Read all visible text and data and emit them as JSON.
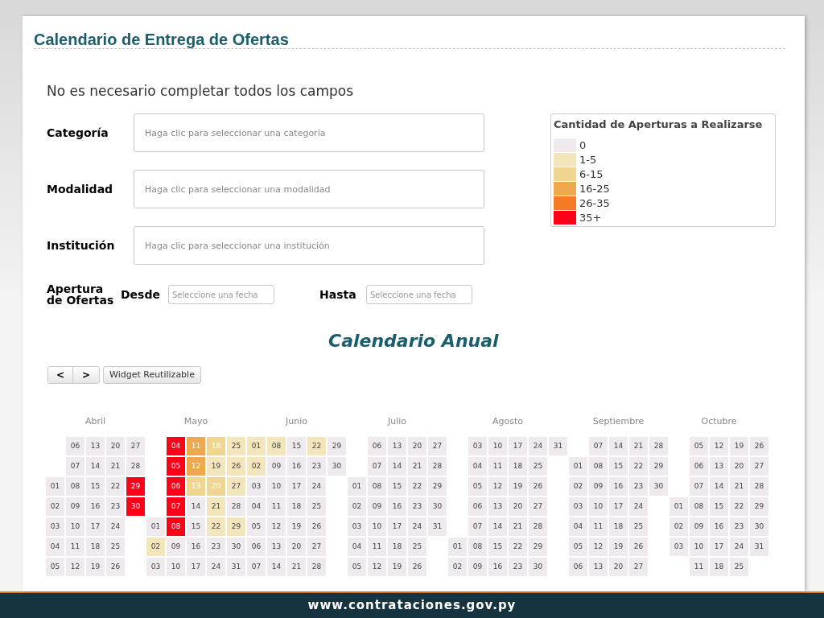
{
  "title": "Calendario de Entrega de Ofertas",
  "intro": "No es necesario completar todos los campos",
  "fields": [
    {
      "label": "Categoría",
      "placeholder": "Haga clic para seleccionar una categoría"
    },
    {
      "label": "Modalidad",
      "placeholder": "Haga clic para seleccionar una modalidad"
    },
    {
      "label": "Institución",
      "placeholder": "Haga clic para seleccionar una institución"
    }
  ],
  "date_range": {
    "label": "Apertura de Ofertas",
    "from_label": "Desde",
    "from_placeholder": "Seleccione una fecha",
    "to_label": "Hasta",
    "to_placeholder": "Seleccione una fecha"
  },
  "legend": {
    "title": "Cantidad de Aperturas a Realizarse",
    "items": [
      {
        "label": "0",
        "color": "#eeeaee"
      },
      {
        "label": "1-5",
        "color": "#f3e6bd"
      },
      {
        "label": "6-15",
        "color": "#f0d690"
      },
      {
        "label": "16-25",
        "color": "#f0a84e"
      },
      {
        "label": "26-35",
        "color": "#f57b26"
      },
      {
        "label": "35+",
        "color": "#ff0018"
      }
    ]
  },
  "calendar_title": "Calendario Anual",
  "nav": {
    "prev": "<",
    "next": ">",
    "widget": "Widget Reutilizable"
  },
  "months": [
    {
      "name": "Abril",
      "weeks": [
        [
          {
            "kind": "blank"
          },
          {
            "kind": "blank"
          },
          {
            "kind": "day",
            "day": "01"
          },
          {
            "kind": "day",
            "day": "02"
          },
          {
            "kind": "day",
            "day": "03"
          },
          {
            "kind": "day",
            "day": "04"
          },
          {
            "kind": "day",
            "day": "05"
          }
        ],
        [
          {
            "kind": "day",
            "day": "06"
          },
          {
            "kind": "day",
            "day": "07"
          },
          {
            "kind": "day",
            "day": "08"
          },
          {
            "kind": "day",
            "day": "09"
          },
          {
            "kind": "day",
            "day": "10"
          },
          {
            "kind": "day",
            "day": "11"
          },
          {
            "kind": "day",
            "day": "12"
          }
        ],
        [
          {
            "kind": "day",
            "day": "13"
          },
          {
            "kind": "day",
            "day": "14"
          },
          {
            "kind": "day",
            "day": "15"
          },
          {
            "kind": "day",
            "day": "16"
          },
          {
            "kind": "day",
            "day": "17"
          },
          {
            "kind": "day",
            "day": "18"
          },
          {
            "kind": "day",
            "day": "19"
          }
        ],
        [
          {
            "kind": "day",
            "day": "20"
          },
          {
            "kind": "day",
            "day": "21"
          },
          {
            "kind": "day",
            "day": "22"
          },
          {
            "kind": "day",
            "day": "23"
          },
          {
            "kind": "day",
            "day": "24"
          },
          {
            "kind": "day",
            "day": "25"
          },
          {
            "kind": "day",
            "day": "26"
          }
        ],
        [
          {
            "kind": "day",
            "day": "27"
          },
          {
            "kind": "day",
            "day": "28"
          },
          {
            "kind": "day",
            "day": "29",
            "color": "#ff0018"
          },
          {
            "kind": "day",
            "day": "30",
            "color": "#ff0018"
          }
        ]
      ]
    },
    {
      "name": "Mayo",
      "weeks": [
        [
          {
            "kind": "blank"
          },
          {
            "kind": "blank"
          },
          {
            "kind": "blank"
          },
          {
            "kind": "blank"
          },
          {
            "kind": "day",
            "day": "01"
          },
          {
            "kind": "day",
            "day": "02",
            "color": "#f3e6bd"
          },
          {
            "kind": "day",
            "day": "03"
          }
        ],
        [
          {
            "kind": "day",
            "day": "04",
            "color": "#ff0018"
          },
          {
            "kind": "day",
            "day": "05",
            "color": "#ff0018"
          },
          {
            "kind": "day",
            "day": "06",
            "color": "#ff0018"
          },
          {
            "kind": "day",
            "day": "07",
            "color": "#ff0018"
          },
          {
            "kind": "day",
            "day": "08",
            "color": "#ff0018"
          },
          {
            "kind": "day",
            "day": "09"
          },
          {
            "kind": "day",
            "day": "10"
          }
        ],
        [
          {
            "kind": "day",
            "day": "11",
            "color": "#f0a84e"
          },
          {
            "kind": "day",
            "day": "12",
            "color": "#f0a84e"
          },
          {
            "kind": "day",
            "day": "13",
            "color": "#f0d690"
          },
          {
            "kind": "day",
            "day": "14"
          },
          {
            "kind": "day",
            "day": "15"
          },
          {
            "kind": "day",
            "day": "16"
          },
          {
            "kind": "day",
            "day": "17"
          }
        ],
        [
          {
            "kind": "day",
            "day": "18",
            "color": "#f0d690"
          },
          {
            "kind": "day",
            "day": "19",
            "color": "#f3e6bd"
          },
          {
            "kind": "day",
            "day": "20",
            "color": "#f0d690"
          },
          {
            "kind": "day",
            "day": "21",
            "color": "#f3e6bd"
          },
          {
            "kind": "day",
            "day": "22",
            "color": "#f3e6bd"
          },
          {
            "kind": "day",
            "day": "23"
          },
          {
            "kind": "day",
            "day": "24"
          }
        ],
        [
          {
            "kind": "day",
            "day": "25",
            "color": "#f3e6bd"
          },
          {
            "kind": "day",
            "day": "26",
            "color": "#f3e6bd"
          },
          {
            "kind": "day",
            "day": "27",
            "color": "#f3e6bd"
          },
          {
            "kind": "day",
            "day": "28"
          },
          {
            "kind": "day",
            "day": "29",
            "color": "#f3e6bd"
          },
          {
            "kind": "day",
            "day": "30"
          },
          {
            "kind": "day",
            "day": "31"
          }
        ]
      ]
    },
    {
      "name": "Junio",
      "weeks": [
        [
          {
            "kind": "day",
            "day": "01",
            "color": "#f3e6bd"
          },
          {
            "kind": "day",
            "day": "02",
            "color": "#f3e6bd"
          },
          {
            "kind": "day",
            "day": "03"
          },
          {
            "kind": "day",
            "day": "04"
          },
          {
            "kind": "day",
            "day": "05"
          },
          {
            "kind": "day",
            "day": "06"
          },
          {
            "kind": "day",
            "day": "07"
          }
        ],
        [
          {
            "kind": "day",
            "day": "08",
            "color": "#f3e6bd"
          },
          {
            "kind": "day",
            "day": "09"
          },
          {
            "kind": "day",
            "day": "10"
          },
          {
            "kind": "day",
            "day": "11"
          },
          {
            "kind": "day",
            "day": "12"
          },
          {
            "kind": "day",
            "day": "13"
          },
          {
            "kind": "day",
            "day": "14"
          }
        ],
        [
          {
            "kind": "day",
            "day": "15"
          },
          {
            "kind": "day",
            "day": "16"
          },
          {
            "kind": "day",
            "day": "17"
          },
          {
            "kind": "day",
            "day": "18"
          },
          {
            "kind": "day",
            "day": "19"
          },
          {
            "kind": "day",
            "day": "20"
          },
          {
            "kind": "day",
            "day": "21"
          }
        ],
        [
          {
            "kind": "day",
            "day": "22",
            "color": "#f3e6bd"
          },
          {
            "kind": "day",
            "day": "23"
          },
          {
            "kind": "day",
            "day": "24"
          },
          {
            "kind": "day",
            "day": "25"
          },
          {
            "kind": "day",
            "day": "26"
          },
          {
            "kind": "day",
            "day": "27"
          },
          {
            "kind": "day",
            "day": "28"
          }
        ],
        [
          {
            "kind": "day",
            "day": "29"
          },
          {
            "kind": "day",
            "day": "30"
          }
        ]
      ]
    },
    {
      "name": "Julio",
      "weeks": [
        [
          {
            "kind": "blank"
          },
          {
            "kind": "blank"
          },
          {
            "kind": "day",
            "day": "01"
          },
          {
            "kind": "day",
            "day": "02"
          },
          {
            "kind": "day",
            "day": "03"
          },
          {
            "kind": "day",
            "day": "04"
          },
          {
            "kind": "day",
            "day": "05"
          }
        ],
        [
          {
            "kind": "day",
            "day": "06"
          },
          {
            "kind": "day",
            "day": "07"
          },
          {
            "kind": "day",
            "day": "08"
          },
          {
            "kind": "day",
            "day": "09"
          },
          {
            "kind": "day",
            "day": "10"
          },
          {
            "kind": "day",
            "day": "11"
          },
          {
            "kind": "day",
            "day": "12"
          }
        ],
        [
          {
            "kind": "day",
            "day": "13"
          },
          {
            "kind": "day",
            "day": "14"
          },
          {
            "kind": "day",
            "day": "15"
          },
          {
            "kind": "day",
            "day": "16"
          },
          {
            "kind": "day",
            "day": "17"
          },
          {
            "kind": "day",
            "day": "18"
          },
          {
            "kind": "day",
            "day": "19"
          }
        ],
        [
          {
            "kind": "day",
            "day": "20"
          },
          {
            "kind": "day",
            "day": "21"
          },
          {
            "kind": "day",
            "day": "22"
          },
          {
            "kind": "day",
            "day": "23"
          },
          {
            "kind": "day",
            "day": "24"
          },
          {
            "kind": "day",
            "day": "25"
          },
          {
            "kind": "day",
            "day": "26"
          }
        ],
        [
          {
            "kind": "day",
            "day": "27"
          },
          {
            "kind": "day",
            "day": "28"
          },
          {
            "kind": "day",
            "day": "29"
          },
          {
            "kind": "day",
            "day": "30"
          },
          {
            "kind": "day",
            "day": "31"
          }
        ]
      ]
    },
    {
      "name": "Agosto",
      "weeks": [
        [
          {
            "kind": "blank"
          },
          {
            "kind": "blank"
          },
          {
            "kind": "blank"
          },
          {
            "kind": "blank"
          },
          {
            "kind": "blank"
          },
          {
            "kind": "day",
            "day": "01"
          },
          {
            "kind": "day",
            "day": "02"
          }
        ],
        [
          {
            "kind": "day",
            "day": "03"
          },
          {
            "kind": "day",
            "day": "04"
          },
          {
            "kind": "day",
            "day": "05"
          },
          {
            "kind": "day",
            "day": "06"
          },
          {
            "kind": "day",
            "day": "07"
          },
          {
            "kind": "day",
            "day": "08"
          },
          {
            "kind": "day",
            "day": "09"
          }
        ],
        [
          {
            "kind": "day",
            "day": "10"
          },
          {
            "kind": "day",
            "day": "11"
          },
          {
            "kind": "day",
            "day": "12"
          },
          {
            "kind": "day",
            "day": "13"
          },
          {
            "kind": "day",
            "day": "14"
          },
          {
            "kind": "day",
            "day": "15"
          },
          {
            "kind": "day",
            "day": "16"
          }
        ],
        [
          {
            "kind": "day",
            "day": "17"
          },
          {
            "kind": "day",
            "day": "18"
          },
          {
            "kind": "day",
            "day": "19"
          },
          {
            "kind": "day",
            "day": "20"
          },
          {
            "kind": "day",
            "day": "21"
          },
          {
            "kind": "day",
            "day": "22"
          },
          {
            "kind": "day",
            "day": "23"
          }
        ],
        [
          {
            "kind": "day",
            "day": "24"
          },
          {
            "kind": "day",
            "day": "25"
          },
          {
            "kind": "day",
            "day": "26"
          },
          {
            "kind": "day",
            "day": "27"
          },
          {
            "kind": "day",
            "day": "28"
          },
          {
            "kind": "day",
            "day": "29"
          },
          {
            "kind": "day",
            "day": "30"
          }
        ],
        [
          {
            "kind": "day",
            "day": "31"
          }
        ]
      ]
    },
    {
      "name": "Septiembre",
      "weeks": [
        [
          {
            "kind": "blank"
          },
          {
            "kind": "day",
            "day": "01"
          },
          {
            "kind": "day",
            "day": "02"
          },
          {
            "kind": "day",
            "day": "03"
          },
          {
            "kind": "day",
            "day": "04"
          },
          {
            "kind": "day",
            "day": "05"
          },
          {
            "kind": "day",
            "day": "06"
          }
        ],
        [
          {
            "kind": "day",
            "day": "07"
          },
          {
            "kind": "day",
            "day": "08"
          },
          {
            "kind": "day",
            "day": "09"
          },
          {
            "kind": "day",
            "day": "10"
          },
          {
            "kind": "day",
            "day": "11"
          },
          {
            "kind": "day",
            "day": "12"
          },
          {
            "kind": "day",
            "day": "13"
          }
        ],
        [
          {
            "kind": "day",
            "day": "14"
          },
          {
            "kind": "day",
            "day": "15"
          },
          {
            "kind": "day",
            "day": "16"
          },
          {
            "kind": "day",
            "day": "17"
          },
          {
            "kind": "day",
            "day": "18"
          },
          {
            "kind": "day",
            "day": "19"
          },
          {
            "kind": "day",
            "day": "20"
          }
        ],
        [
          {
            "kind": "day",
            "day": "21"
          },
          {
            "kind": "day",
            "day": "22"
          },
          {
            "kind": "day",
            "day": "23"
          },
          {
            "kind": "day",
            "day": "24"
          },
          {
            "kind": "day",
            "day": "25"
          },
          {
            "kind": "day",
            "day": "26"
          },
          {
            "kind": "day",
            "day": "27"
          }
        ],
        [
          {
            "kind": "day",
            "day": "28"
          },
          {
            "kind": "day",
            "day": "29"
          },
          {
            "kind": "day",
            "day": "30"
          }
        ]
      ]
    },
    {
      "name": "Octubre",
      "weeks": [
        [
          {
            "kind": "blank"
          },
          {
            "kind": "blank"
          },
          {
            "kind": "blank"
          },
          {
            "kind": "day",
            "day": "01"
          },
          {
            "kind": "day",
            "day": "02"
          },
          {
            "kind": "day",
            "day": "03"
          }
        ],
        [
          {
            "kind": "day",
            "day": "05"
          },
          {
            "kind": "day",
            "day": "06"
          },
          {
            "kind": "day",
            "day": "07"
          },
          {
            "kind": "day",
            "day": "08"
          },
          {
            "kind": "day",
            "day": "09"
          },
          {
            "kind": "day",
            "day": "10"
          },
          {
            "kind": "day",
            "day": "11"
          }
        ],
        [
          {
            "kind": "day",
            "day": "12"
          },
          {
            "kind": "day",
            "day": "13"
          },
          {
            "kind": "day",
            "day": "14"
          },
          {
            "kind": "day",
            "day": "15"
          },
          {
            "kind": "day",
            "day": "16"
          },
          {
            "kind": "day",
            "day": "17"
          },
          {
            "kind": "day",
            "day": "18"
          }
        ],
        [
          {
            "kind": "day",
            "day": "19"
          },
          {
            "kind": "day",
            "day": "20"
          },
          {
            "kind": "day",
            "day": "21"
          },
          {
            "kind": "day",
            "day": "22"
          },
          {
            "kind": "day",
            "day": "23"
          },
          {
            "kind": "day",
            "day": "24"
          },
          {
            "kind": "day",
            "day": "25"
          }
        ],
        [
          {
            "kind": "day",
            "day": "26"
          },
          {
            "kind": "day",
            "day": "27"
          },
          {
            "kind": "day",
            "day": "28"
          },
          {
            "kind": "day",
            "day": "29"
          },
          {
            "kind": "day",
            "day": "30"
          },
          {
            "kind": "day",
            "day": "31"
          }
        ]
      ]
    }
  ],
  "footer": "www.contrataciones.gov.py"
}
